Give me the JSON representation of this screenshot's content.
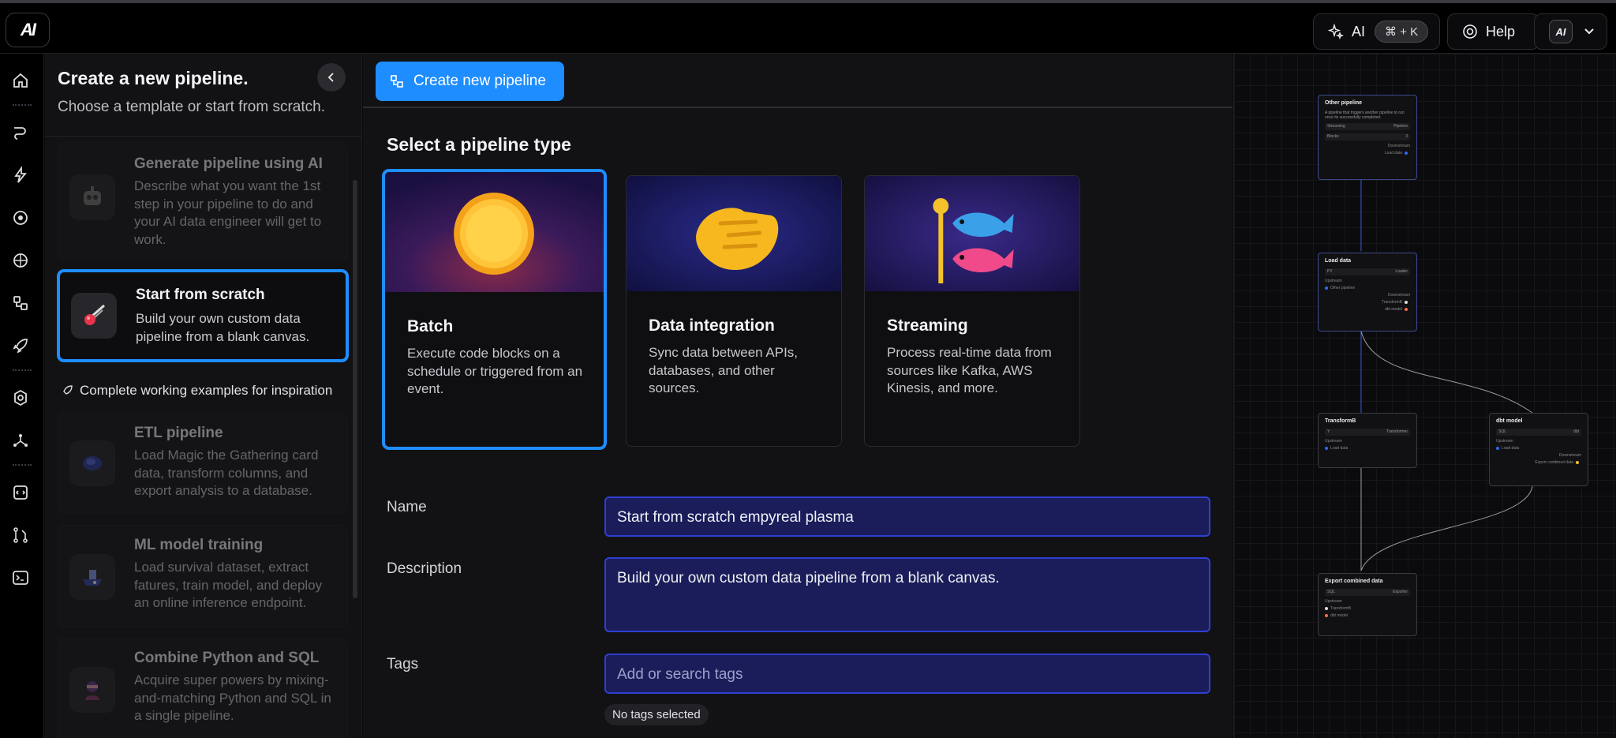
{
  "app": {
    "logo_text": "AI"
  },
  "topbar": {
    "ai_label": "AI",
    "ai_shortcut": "⌘ + K",
    "help_label": "Help",
    "user_avatar": "AI"
  },
  "left_panel": {
    "title": "Create a new pipeline.",
    "subtitle": "Choose a template or start from scratch.",
    "templates": [
      {
        "title": "Generate pipeline using AI",
        "description": "Describe what you want the 1st step in your pipeline to do and your AI data engineer will get to work.",
        "icon": "robot-icon",
        "state": "disabled"
      },
      {
        "title": "Start from scratch",
        "description": "Build your own custom data pipeline from a blank canvas.",
        "icon": "comet-icon",
        "state": "selected"
      }
    ],
    "examples_heading": "Complete working examples for inspiration",
    "examples": [
      {
        "title": "ETL pipeline",
        "description": "Load Magic the Gathering card data, transform columns, and export analysis to a database.",
        "icon": "cards-icon"
      },
      {
        "title": "ML model training",
        "description": "Load survival dataset, extract fatures, train model, and deploy an online inference endpoint.",
        "icon": "ship-icon"
      },
      {
        "title": "Combine Python and SQL",
        "description": "Acquire super powers by mixing-and-matching Python and SQL in a single pipeline.",
        "icon": "ninja-icon"
      }
    ]
  },
  "main": {
    "create_button_label": "Create new pipeline",
    "select_title": "Select a pipeline type",
    "pipeline_types": [
      {
        "title": "Batch",
        "description": "Execute code blocks on a schedule or triggered from an event.",
        "art": "sun-icon",
        "selected": true
      },
      {
        "title": "Data integration",
        "description": "Sync data between APIs, databases, and other sources.",
        "art": "handshake-icon",
        "selected": false
      },
      {
        "title": "Streaming",
        "description": "Process real-time data from sources like Kafka, AWS Kinesis, and more.",
        "art": "fish-flag-icon",
        "selected": false
      }
    ],
    "form": {
      "name_label": "Name",
      "name_value": "Start from scratch empyreal plasma",
      "description_label": "Description",
      "description_value": "Build your own custom data pipeline from a blank canvas.",
      "tags_label": "Tags",
      "tags_placeholder": "Add or search tags",
      "tags_status": "No tags selected"
    }
  },
  "canvas": {
    "nodes": [
      {
        "title": "Other pipeline",
        "desc": "A pipeline that triggers another pipeline to run once its successfully completed.",
        "rows": [
          [
            "Streaming",
            "Pipeline"
          ],
          [
            "Blocks",
            "3"
          ]
        ],
        "downstream": "Downstream",
        "links": [
          "Load data"
        ]
      },
      {
        "title": "Load data",
        "rows": [
          [
            "PY",
            "Loader"
          ]
        ],
        "upstream": "Upstream",
        "up_links": [
          "Other pipeline"
        ],
        "downstream": "Downstream",
        "links": [
          "TransformB",
          "dbt model"
        ]
      },
      {
        "title": "TransformB",
        "rows": [
          [
            "Y",
            "Transformer"
          ]
        ],
        "upstream": "Upstream",
        "up_links": [
          "Load data"
        ]
      },
      {
        "title": "dbt model",
        "rows": [
          [
            "SQL",
            "dbt"
          ]
        ],
        "upstream": "Upstream",
        "up_links": [
          "Load data"
        ],
        "downstream": "Downstream",
        "links": [
          "Export combined data"
        ]
      },
      {
        "title": "Export combined data",
        "rows": [
          [
            "SQL",
            "Exporter"
          ]
        ],
        "upstream": "Upstream",
        "up_links": [
          "TransformB",
          "dbt model"
        ]
      }
    ]
  },
  "colors": {
    "accent": "#1e8dff",
    "input_bg": "#1a1d5a",
    "input_border": "#2f3fd0"
  }
}
